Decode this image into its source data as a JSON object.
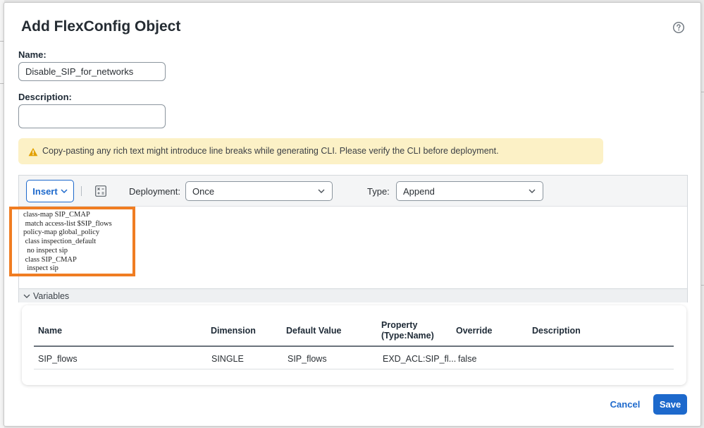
{
  "dialog": {
    "title": "Add FlexConfig Object",
    "help_icon": "question-circle-icon"
  },
  "form": {
    "name_label": "Name:",
    "name_value": "Disable_SIP_for_networks",
    "description_label": "Description:",
    "description_value": ""
  },
  "alert": {
    "icon": "warning-triangle-icon",
    "color": "#fcf1c6",
    "text": "Copy-pasting any rich text might introduce line breaks while generating CLI. Please verify the CLI before deployment."
  },
  "toolbar": {
    "insert_label": "Insert",
    "variable_icon": "variable-grid-icon",
    "deployment_label": "Deployment:",
    "deployment_value": "Once",
    "type_label": "Type:",
    "type_value": "Append"
  },
  "code": {
    "lines": [
      "class-map SIP_CMAP",
      " match access-list $SIP_flows",
      "policy-map global_policy",
      " class inspection_default",
      "  no inspect sip",
      " class SIP_CMAP",
      "  inspect sip"
    ],
    "highlight_color": "#f07d22"
  },
  "variables": {
    "section_label": "Variables",
    "columns": [
      "Name",
      "Dimension",
      "Default Value",
      "Property (Type:Name)",
      "Override",
      "Description"
    ],
    "rows": [
      {
        "name": "SIP_flows",
        "dimension": "SINGLE",
        "default_value": "SIP_flows",
        "property": "EXD_ACL:SIP_fl...",
        "override": "false",
        "description": ""
      }
    ]
  },
  "footer": {
    "cancel_label": "Cancel",
    "save_label": "Save",
    "accent_color": "#1d69cc"
  }
}
